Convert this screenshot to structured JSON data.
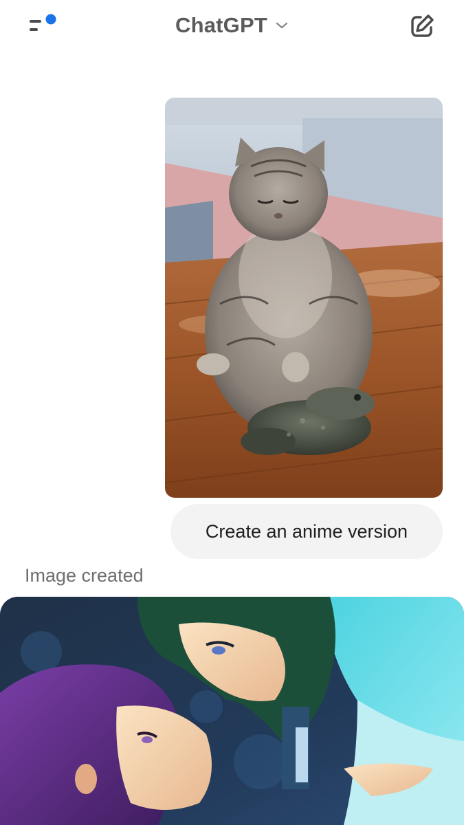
{
  "header": {
    "title": "ChatGPT",
    "menu_icon": "sidebar-menu-icon",
    "new_chat_icon": "new-chat-edit-icon",
    "notification_color": "#1a73e8"
  },
  "conversation": {
    "user_image": {
      "description_icon": "uploaded-photo-cat-and-frog"
    },
    "user_message": "Create an anime version",
    "assistant_status": "Image created",
    "generated_image": {
      "description_icon": "generated-anime-image"
    }
  }
}
